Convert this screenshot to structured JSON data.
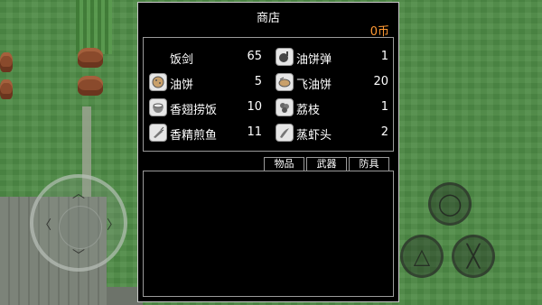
{
  "shop": {
    "title": "商店",
    "money": "0币",
    "items": [
      {
        "name": "饭剑",
        "price": "65",
        "icon": "sword-icon"
      },
      {
        "name": "油饼弹",
        "price": "1",
        "icon": "pancake-bomb-icon"
      },
      {
        "name": "油饼",
        "price": "5",
        "icon": "pancake-icon"
      },
      {
        "name": "飞油饼",
        "price": "20",
        "icon": "flying-pancake-icon"
      },
      {
        "name": "香翅捞饭",
        "price": "10",
        "icon": "rice-bowl-icon"
      },
      {
        "name": "荔枝",
        "price": "1",
        "icon": "lychee-icon"
      },
      {
        "name": "香精煎鱼",
        "price": "11",
        "icon": "fried-fish-icon"
      },
      {
        "name": "蒸虾头",
        "price": "2",
        "icon": "shrimp-icon"
      }
    ],
    "tabs": [
      "物品",
      "武器",
      "防具"
    ]
  },
  "controls": {
    "joystick": {
      "up": "︿",
      "down": "﹀",
      "left": "〈",
      "right": "〉"
    },
    "buttons": {
      "circle": "◯",
      "triangle": "△",
      "cross": "╳"
    }
  }
}
